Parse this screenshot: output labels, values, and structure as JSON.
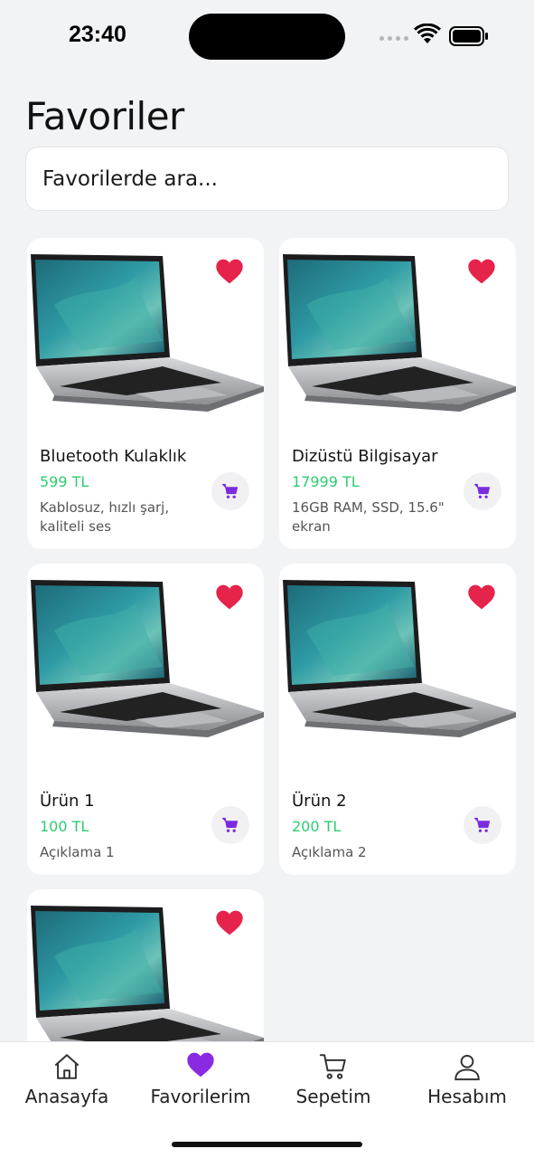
{
  "status_bar": {
    "time": "23:40"
  },
  "page": {
    "title": "Favoriler",
    "search_placeholder": "Favorilerde ara..."
  },
  "products": [
    {
      "name": "Bluetooth Kulaklık",
      "price": "599 TL",
      "description": "Kablosuz, hızlı şarj, kaliteli ses"
    },
    {
      "name": "Dizüstü Bilgisayar",
      "price": "17999 TL",
      "description": "16GB RAM, SSD, 15.6\" ekran"
    },
    {
      "name": "Ürün 1",
      "price": "100 TL",
      "description": "Açıklama 1"
    },
    {
      "name": "Ürün 2",
      "price": "200 TL",
      "description": "Açıklama 2"
    },
    {
      "name": "",
      "price": "",
      "description": ""
    }
  ],
  "tab_bar": {
    "tabs": [
      {
        "label": "Anasayfa",
        "icon": "home-icon",
        "active": false
      },
      {
        "label": "Favorilerim",
        "icon": "heart-icon",
        "active": true
      },
      {
        "label": "Sepetim",
        "icon": "cart-icon",
        "active": false
      },
      {
        "label": "Hesabım",
        "icon": "user-icon",
        "active": false
      }
    ]
  },
  "colors": {
    "accent": "#7a2ce0",
    "price": "#2ecc71",
    "heart": "#e5234b",
    "background": "#f2f3f5"
  }
}
